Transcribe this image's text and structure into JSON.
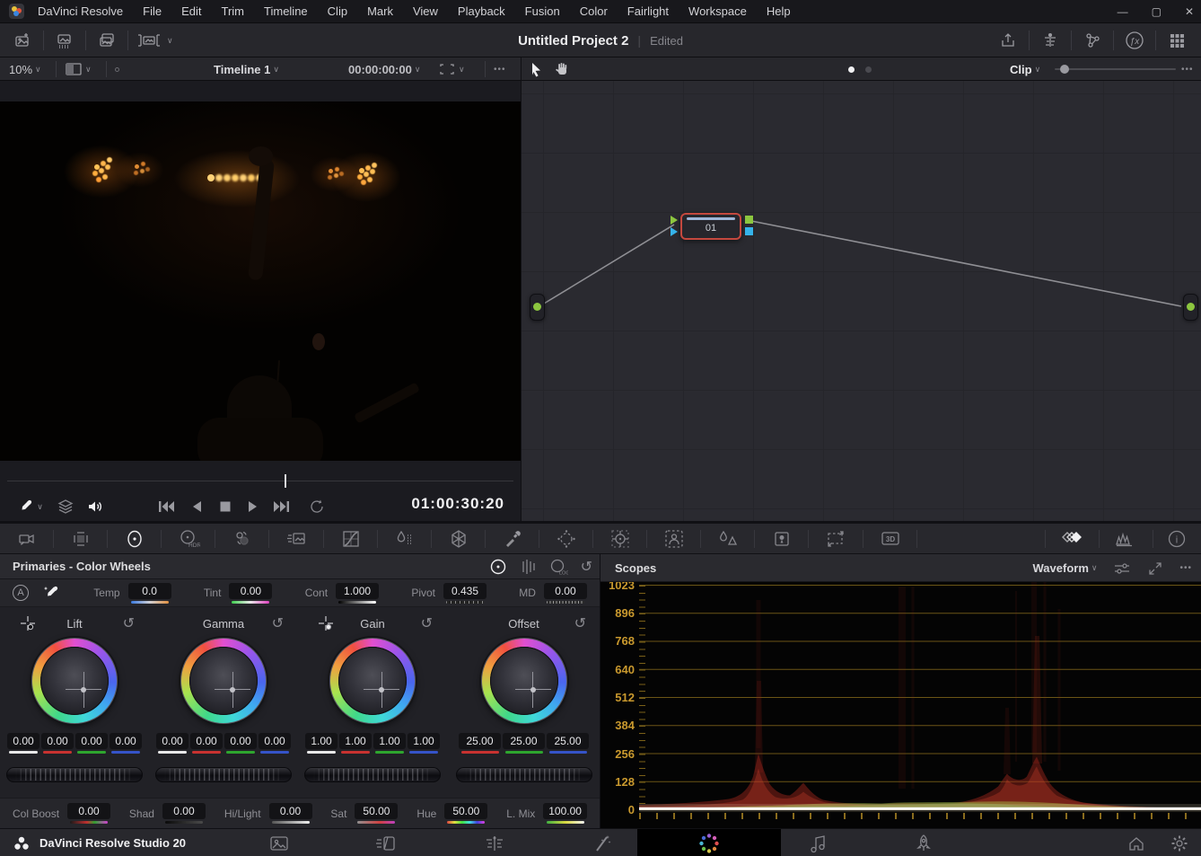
{
  "icons": {
    "chevron_down": "∨",
    "more": "•••",
    "minimize": "—",
    "maximize": "▢",
    "close": "✕",
    "reset": "↺",
    "auto_label": "A",
    "fx_label": "ƒx",
    "hdr_label": "HDR",
    "log_label": "LOG",
    "threed_label": "3D",
    "info_label": "i"
  },
  "menu_bar": {
    "items": [
      "DaVinci Resolve",
      "File",
      "Edit",
      "Trim",
      "Timeline",
      "Clip",
      "Mark",
      "View",
      "Playback",
      "Fusion",
      "Color",
      "Fairlight",
      "Workspace",
      "Help"
    ]
  },
  "header": {
    "title": "Untitled Project 2",
    "status": "Edited"
  },
  "viewer_toolbar": {
    "zoom_level": "10%",
    "timeline_selector": "Timeline 1",
    "timecode": "00:00:00:00"
  },
  "node_toolbar": {
    "mode": "Clip"
  },
  "transport": {
    "timecode": "01:00:30:20"
  },
  "node_graph": {
    "node_label": "01"
  },
  "primaries": {
    "title": "Primaries - Color Wheels",
    "adjustments": [
      {
        "label": "Temp",
        "value": "0.0"
      },
      {
        "label": "Tint",
        "value": "0.00"
      },
      {
        "label": "Cont",
        "value": "1.000"
      },
      {
        "label": "Pivot",
        "value": "0.435"
      },
      {
        "label": "MD",
        "value": "0.00"
      }
    ],
    "wheels": [
      {
        "name": "Lift",
        "values": [
          "0.00",
          "0.00",
          "0.00",
          "0.00"
        ]
      },
      {
        "name": "Gamma",
        "values": [
          "0.00",
          "0.00",
          "0.00",
          "0.00"
        ]
      },
      {
        "name": "Gain",
        "values": [
          "1.00",
          "1.00",
          "1.00",
          "1.00"
        ]
      },
      {
        "name": "Offset",
        "values": [
          "25.00",
          "25.00",
          "25.00"
        ]
      }
    ],
    "footer_adjustments": [
      {
        "label": "Col Boost",
        "value": "0.00"
      },
      {
        "label": "Shad",
        "value": "0.00"
      },
      {
        "label": "Hi/Light",
        "value": "0.00"
      },
      {
        "label": "Sat",
        "value": "50.00"
      },
      {
        "label": "Hue",
        "value": "50.00"
      },
      {
        "label": "L. Mix",
        "value": "100.00"
      }
    ]
  },
  "scopes": {
    "title": "Scopes",
    "mode": "Waveform",
    "y_ticks": [
      "1023",
      "896",
      "768",
      "640",
      "512",
      "384",
      "256",
      "128",
      "0"
    ]
  },
  "taskbar": {
    "brand": "DaVinci Resolve Studio 20"
  }
}
